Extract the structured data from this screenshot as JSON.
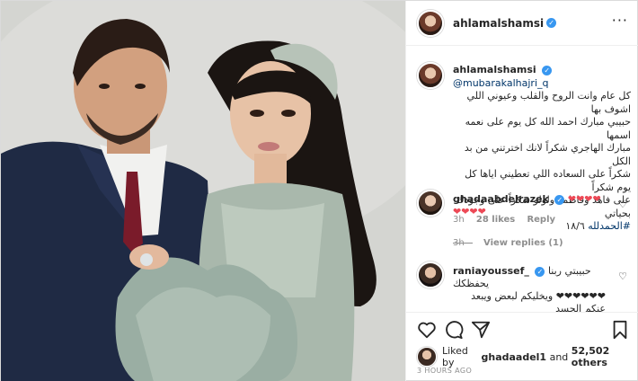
{
  "post": {
    "username": "ahlamalshamsi",
    "verified_icon": "verified-badge-icon",
    "more_icon": "more-options-icon",
    "caption": {
      "username": "ahlamalshamsi",
      "mention": "@mubarakalhajri_q",
      "line1": "كل عام وانت الروح والقلب وعيوني اللي اشوف بها",
      "line2": "حبيبي مبارك احمد الله كل يوم على نعمه اسمها",
      "line3": "مبارك الهاجري شكراً لانك اخترتني من بد الكل",
      "line4": "شكراً على السعاده اللي تعطيني اياها كل يوم شكراً",
      "line5": "على فاهد وفاطمه ولولو شكراً على وجودك بحياتي",
      "line6_date": "١٨/٦",
      "line6_tag": "#الحمدلله",
      "age": "3h"
    },
    "comments": [
      {
        "username": "ghadaabdelrazek",
        "text": "❤❤❤❤❤❤❤❤",
        "age": "3h",
        "likes": "28 likes",
        "reply": "Reply",
        "view_replies": "View replies (1)"
      },
      {
        "username": "raniayoussef_",
        "text_line1": "حبيبتي ربنا يحفظكك",
        "text_line2": "❤❤❤❤❤❤ ويخليكم لبعض ويبعد عنكم الحسد",
        "text_line3": "❤❤❤❤"
      }
    ],
    "actions": {
      "like_icon": "heart-icon",
      "comment_icon": "comment-icon",
      "share_icon": "share-icon",
      "save_icon": "bookmark-icon"
    },
    "likes": {
      "prefix": "Liked by",
      "user": "ghadaadel1",
      "and": "and",
      "others": "52,502 others"
    },
    "timestamp": "3 HOURS AGO"
  }
}
